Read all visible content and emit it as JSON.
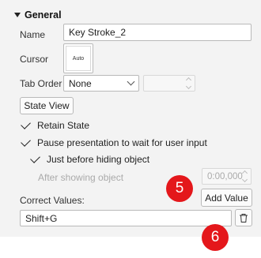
{
  "section": {
    "title": "General"
  },
  "name_field": {
    "label": "Name",
    "value": "Key Stroke_2"
  },
  "cursor_field": {
    "label": "Cursor",
    "preview": "Auto"
  },
  "tab_order": {
    "label": "Tab Order",
    "selected": "None",
    "number_value": ""
  },
  "state_view_button": "State View",
  "options": {
    "retain_state": "Retain State",
    "pause_presentation": "Pause presentation to wait for user input",
    "just_before_hiding": "Just before hiding object",
    "after_showing": "After showing object",
    "after_showing_time": "0:00,000"
  },
  "correct_values": {
    "label": "Correct Values:",
    "add_button": "Add Value",
    "items": [
      "Shift+G"
    ]
  },
  "badges": {
    "add_value_step": "5",
    "delete_step": "6"
  },
  "colors": {
    "badge_red": "#e4171b",
    "panel_bg": "#f3f3f3"
  }
}
